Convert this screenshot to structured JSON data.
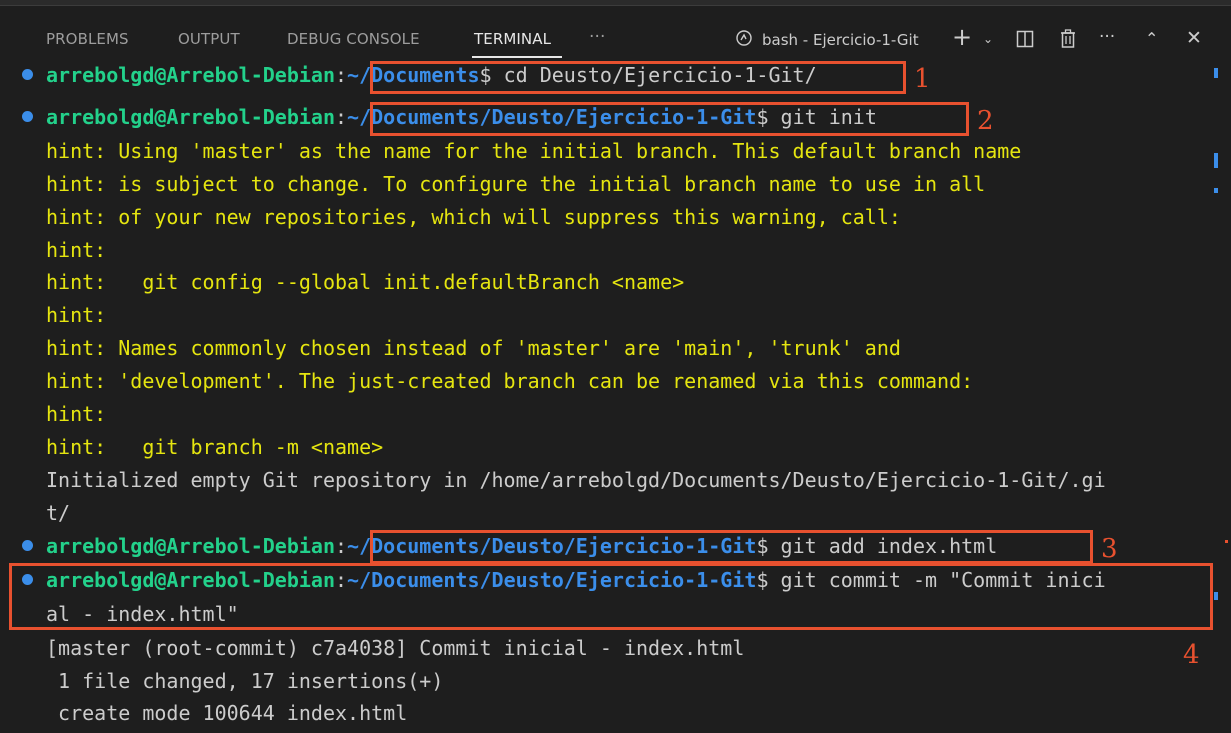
{
  "tabs": {
    "problems": "PROBLEMS",
    "output": "OUTPUT",
    "debug_console": "DEBUG CONSOLE",
    "terminal": "TERMINAL",
    "more": "···"
  },
  "terminal_instance": {
    "label": "bash - Ejercicio-1-Git"
  },
  "toolbar_icons": [
    "terminal-icon",
    "plus-icon",
    "chevron-down-icon",
    "split-icon",
    "trash-icon",
    "more-icon",
    "chevron-up-icon",
    "close-icon"
  ],
  "prompt": {
    "user_host": "arrebolgd@Arrebol-Debian",
    "sep": ":",
    "dollar": "$"
  },
  "lines": {
    "l1_path": "~/Documents",
    "l1_cmd": " cd Deusto/Ejercicio-1-Git/",
    "l2_path": "~/Documents/Deusto/Ejercicio-1-Git",
    "l2_cmd": " git init",
    "h1": "hint: Using 'master' as the name for the initial branch. This default branch name",
    "h2": "hint: is subject to change. To configure the initial branch name to use in all",
    "h3": "hint: of your new repositories, which will suppress this warning, call:",
    "h4": "hint:",
    "h5": "hint:   git config --global init.defaultBranch <name>",
    "h6": "hint:",
    "h7": "hint: Names commonly chosen instead of 'master' are 'main', 'trunk' and",
    "h8": "hint: 'development'. The just-created branch can be renamed via this command:",
    "h9": "hint:",
    "h10": "hint:   git branch -m <name>",
    "init1": "Initialized empty Git repository in /home/arrebolgd/Documents/Deusto/Ejercicio-1-Git/.gi",
    "init2": "t/",
    "l3_path": "~/Documents/Deusto/Ejercicio-1-Git",
    "l3_cmd": " git add index.html",
    "l4_path": "~/Documents/Deusto/Ejercicio-1-Git",
    "l4_cmd": " git commit -m \"Commit inici",
    "l4_cont": "al - index.html\"",
    "out1": "[master (root-commit) c7a4038] Commit inicial - index.html",
    "out2": " 1 file changed, 17 insertions(+)",
    "out3": " create mode 100644 index.html"
  },
  "annotations": [
    "1",
    "2",
    "3",
    "4"
  ],
  "colors": {
    "background": "#1e1e1e",
    "user": "#23d18b",
    "path": "#3b8eea",
    "hint": "#e5e510",
    "highlight": "#e8512f"
  }
}
